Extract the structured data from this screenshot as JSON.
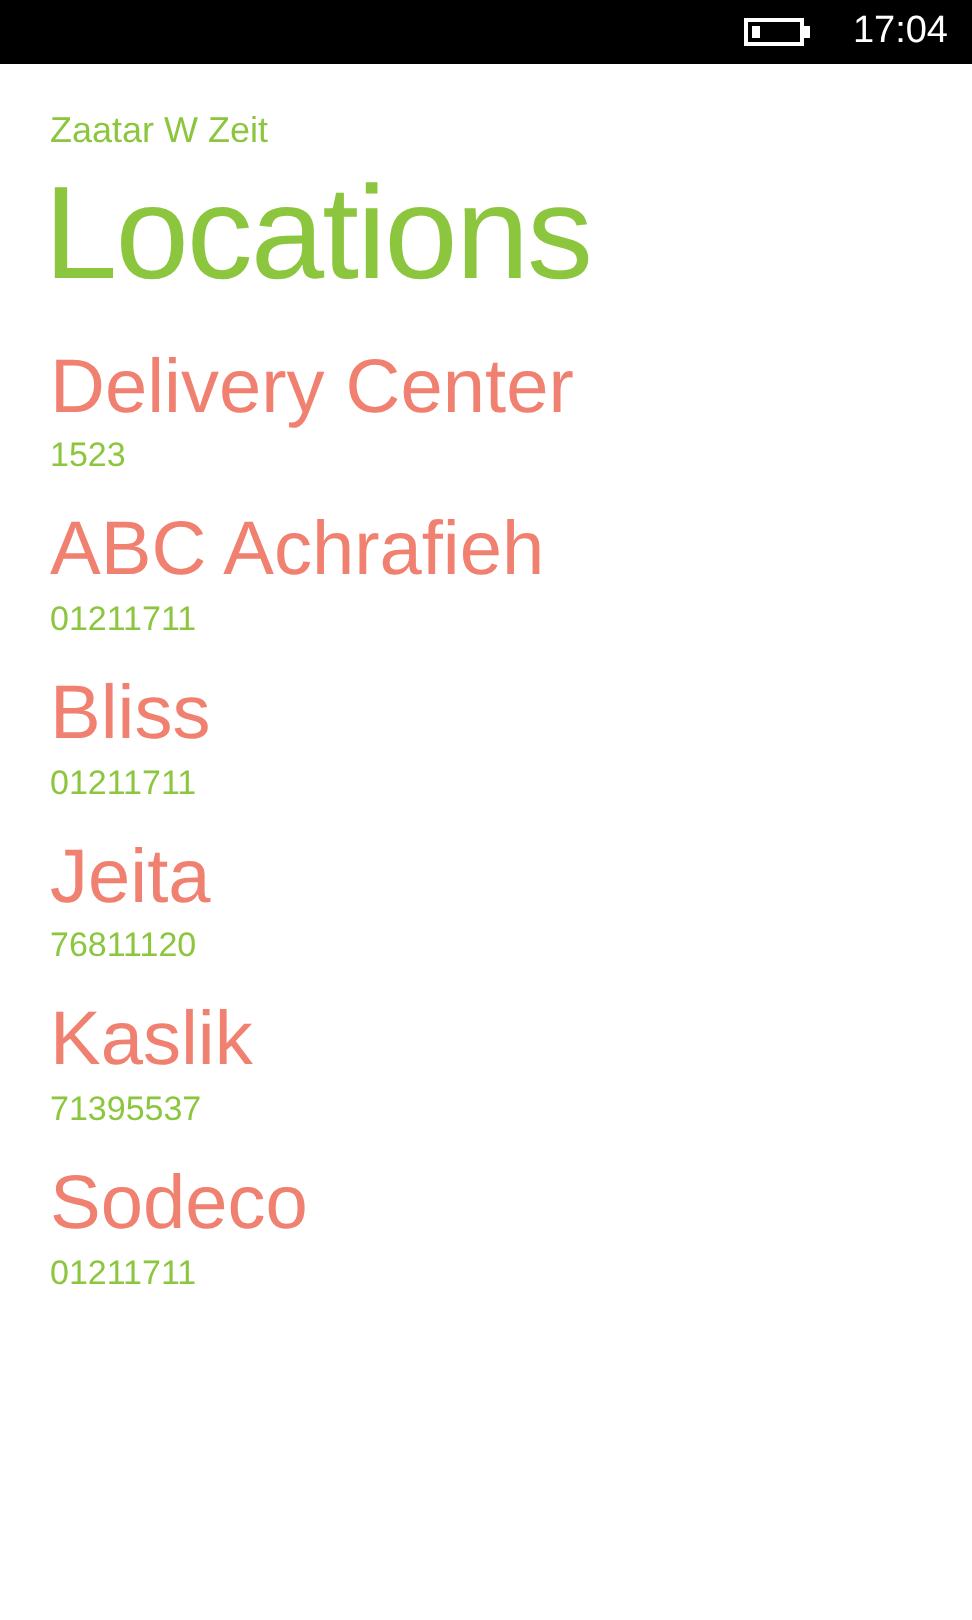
{
  "status_bar": {
    "time": "17:04"
  },
  "app_name": "Zaatar W Zeit",
  "title": "Locations",
  "locations": [
    {
      "name": "Delivery Center",
      "phone": "1523"
    },
    {
      "name": "ABC Achrafieh",
      "phone": "01211711"
    },
    {
      "name": "Bliss",
      "phone": "01211711"
    },
    {
      "name": "Jeita",
      "phone": "76811120"
    },
    {
      "name": "Kaslik",
      "phone": "71395537"
    },
    {
      "name": "Sodeco",
      "phone": "01211711"
    }
  ]
}
